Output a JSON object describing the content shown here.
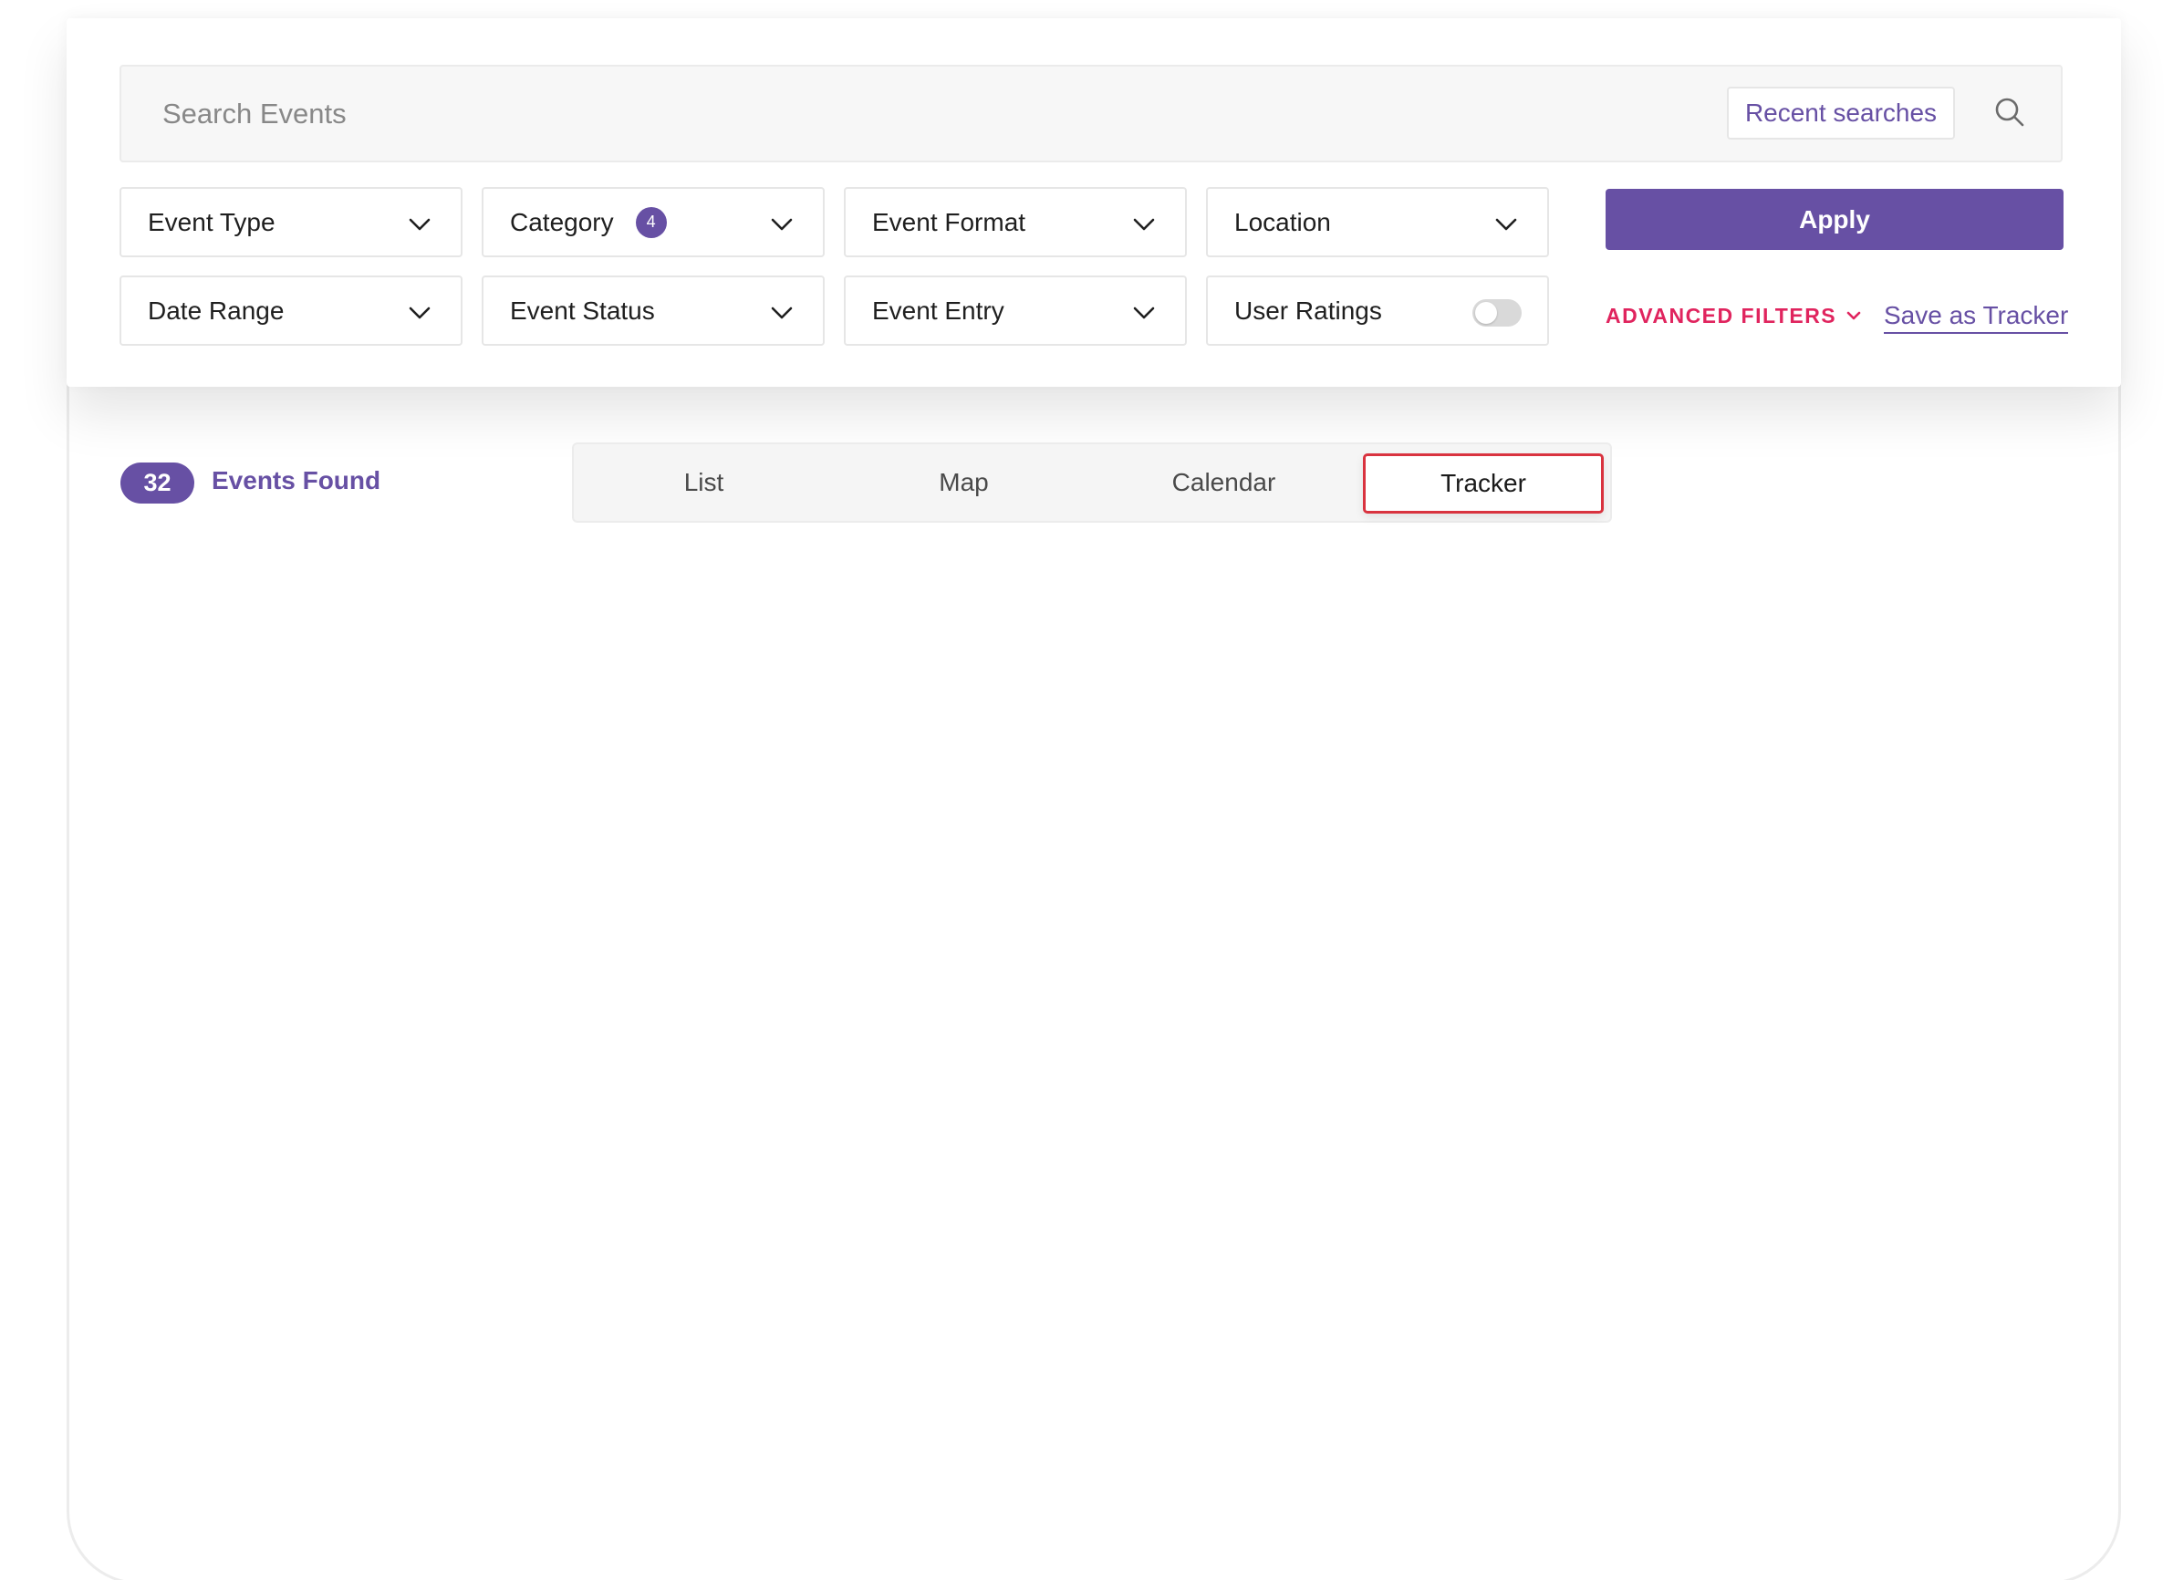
{
  "search": {
    "placeholder": "Search Events",
    "recent_label": "Recent searches"
  },
  "filters": {
    "event_type": "Event Type",
    "category": "Category",
    "category_count": "4",
    "event_format": "Event Format",
    "location": "Location",
    "date_range": "Date Range",
    "event_status": "Event Status",
    "event_entry": "Event Entry",
    "user_ratings": "User Ratings",
    "user_ratings_on": false
  },
  "actions": {
    "apply_label": "Apply",
    "advanced_filters_label": "ADVANCED FILTERS",
    "save_tracker_label": "Save as Tracker"
  },
  "results": {
    "count": "32",
    "label": "Events Found"
  },
  "view_tabs": [
    {
      "label": "List",
      "active": false
    },
    {
      "label": "Map",
      "active": false
    },
    {
      "label": "Calendar",
      "active": false
    },
    {
      "label": "Tracker",
      "active": true
    }
  ],
  "colors": {
    "accent": "#6750a4",
    "advanced": "#e0245e",
    "highlight": "#d9333f"
  },
  "icons": {
    "search": "search-icon",
    "dropdown": "chevron-down-icon"
  }
}
